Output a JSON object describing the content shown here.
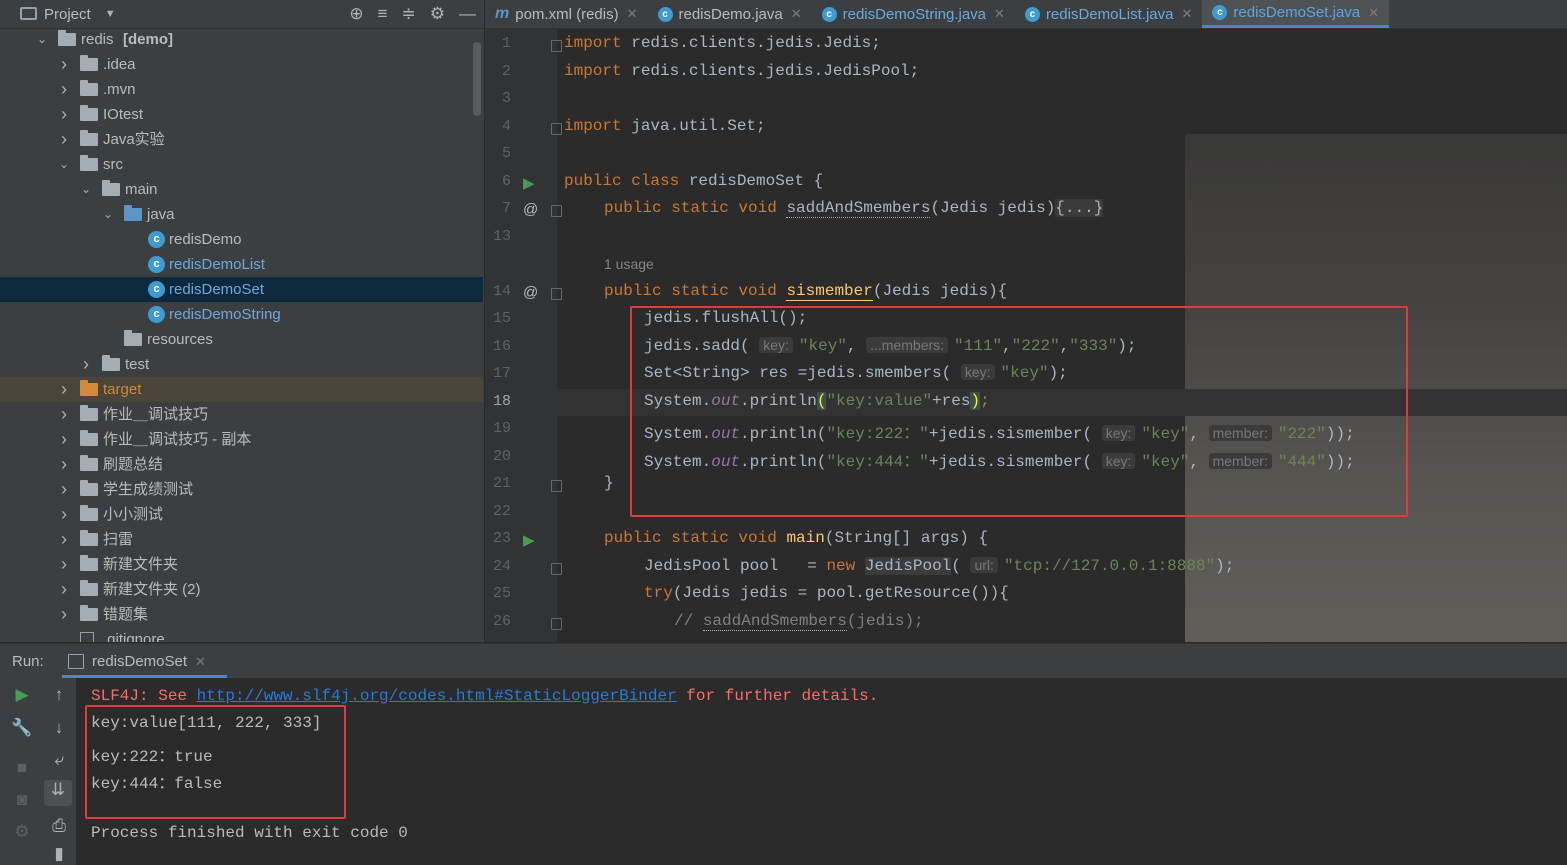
{
  "project_panel": {
    "title": "Project",
    "tree": [
      {
        "label": "redis",
        "suffix": "[demo]",
        "level": 0,
        "arrow": "down",
        "icon": "module-folder"
      },
      {
        "label": ".idea",
        "level": 1,
        "arrow": "right",
        "icon": "folder"
      },
      {
        "label": ".mvn",
        "level": 1,
        "arrow": "right",
        "icon": "folder"
      },
      {
        "label": "IOtest",
        "level": 1,
        "arrow": "right",
        "icon": "folder"
      },
      {
        "label": "Java实验",
        "level": 1,
        "arrow": "right",
        "icon": "folder"
      },
      {
        "label": "src",
        "level": 1,
        "arrow": "down",
        "icon": "folder"
      },
      {
        "label": "main",
        "level": 2,
        "arrow": "down",
        "icon": "folder"
      },
      {
        "label": "java",
        "level": 3,
        "arrow": "down",
        "icon": "blue-folder"
      },
      {
        "label": "redisDemo",
        "level": 4,
        "icon": "class"
      },
      {
        "label": "redisDemoList",
        "level": 4,
        "icon": "class",
        "color": "#6fa9dc"
      },
      {
        "label": "redisDemoSet",
        "level": 4,
        "icon": "class",
        "color": "#6fa9dc",
        "selected": true
      },
      {
        "label": "redisDemoString",
        "level": 4,
        "icon": "class",
        "color": "#6fa9dc"
      },
      {
        "label": "resources",
        "level": 3,
        "icon": "resources-folder"
      },
      {
        "label": "test",
        "level": 2,
        "arrow": "right",
        "icon": "folder"
      },
      {
        "label": "target",
        "level": 1,
        "arrow": "right",
        "icon": "orange-folder",
        "color": "#d08a3a",
        "target": true
      },
      {
        "label": "作业＿调试技巧",
        "level": 1,
        "arrow": "right",
        "icon": "folder"
      },
      {
        "label": "作业＿调试技巧 - 副本",
        "level": 1,
        "arrow": "right",
        "icon": "folder"
      },
      {
        "label": "刷题总结",
        "level": 1,
        "arrow": "right",
        "icon": "folder"
      },
      {
        "label": "学生成绩测试",
        "level": 1,
        "arrow": "right",
        "icon": "folder"
      },
      {
        "label": "小小测试",
        "level": 1,
        "arrow": "right",
        "icon": "folder"
      },
      {
        "label": "扫雷",
        "level": 1,
        "arrow": "right",
        "icon": "folder"
      },
      {
        "label": "新建文件夹",
        "level": 1,
        "arrow": "right",
        "icon": "folder"
      },
      {
        "label": "新建文件夹 (2)",
        "level": 1,
        "arrow": "right",
        "icon": "folder"
      },
      {
        "label": "错题集",
        "level": 1,
        "arrow": "right",
        "icon": "folder"
      },
      {
        "label": ".gitignore",
        "level": 1,
        "icon": "file"
      }
    ]
  },
  "tabs": [
    {
      "label": "pom.xml (redis)",
      "icon": "maven"
    },
    {
      "label": "redisDemo.java",
      "icon": "class"
    },
    {
      "label": "redisDemoString.java",
      "icon": "class",
      "blue": true
    },
    {
      "label": "redisDemoList.java",
      "icon": "class",
      "blue": true
    },
    {
      "label": "redisDemoSet.java",
      "icon": "class",
      "active": true
    }
  ],
  "editor": {
    "line_numbers": [
      "1",
      "2",
      "3",
      "4",
      "5",
      "6",
      "7",
      "13",
      "",
      "14",
      "15",
      "16",
      "17",
      "18",
      "19",
      "20",
      "21",
      "22",
      "23",
      "24",
      "25",
      "26"
    ],
    "usage_hint": "1 usage",
    "code": {
      "l1": [
        "import",
        " redis.clients.jedis.Jedis;"
      ],
      "l2": [
        "import",
        " redis.clients.jedis.JedisPool;"
      ],
      "l4": [
        "import",
        " java.util.Set;"
      ],
      "l6": [
        "public class",
        " redisDemoSet {"
      ],
      "l7": [
        "public static void",
        " ",
        "saddAndSmembers",
        "(Jedis jedis)",
        "{...}"
      ],
      "l14": [
        "public static void",
        " ",
        "sismember",
        "(Jedis jedis){"
      ],
      "l15": "jedis.flushAll();",
      "l16": [
        "jedis.sadd( ",
        "key:",
        "\"key\"",
        ", ",
        "...members:",
        "\"111\"",
        ",",
        "\"222\"",
        ",",
        "\"333\"",
        ");"
      ],
      "l17": [
        "Set<String> res =jedis.smembers( ",
        "key:",
        "\"key\"",
        ");"
      ],
      "l18": [
        "System.",
        "out",
        ".println",
        "(",
        "\"key:value\"",
        "+res",
        ")",
        ";"
      ],
      "l19": [
        "System.",
        "out",
        ".println(",
        "\"key:222：\"",
        "+jedis.sismember( ",
        "key:",
        "\"key\"",
        ", ",
        "member:",
        "\"222\"",
        "));"
      ],
      "l20": [
        "System.",
        "out",
        ".println(",
        "\"key:444：\"",
        "+jedis.sismember( ",
        "key:",
        "\"key\"",
        ", ",
        "member:",
        "\"444\"",
        "));"
      ],
      "l21": "}",
      "l23": [
        "public static void",
        " ",
        "main",
        "(String[] args) {"
      ],
      "l24": [
        "JedisPool pool   = ",
        "new",
        " ",
        "JedisPool",
        "( ",
        "url:",
        "\"tcp://127.0.0.1:8888\"",
        ");"
      ],
      "l25": [
        "try",
        "(Jedis jedis = pool.getResource()){"
      ],
      "l26": [
        "// ",
        "saddAndSmembers",
        "(jedis);"
      ]
    }
  },
  "run_panel": {
    "label": "Run:",
    "tab": "redisDemoSet",
    "console": {
      "slf4j_prefix": "SLF4J: See ",
      "slf4j_link": "http://www.slf4j.org/codes.html#StaticLoggerBinder",
      "slf4j_suffix": " for further details.",
      "output": [
        "key:value[111, 222, 333]",
        "key:222：true",
        "key:444：false"
      ],
      "finish": "Process finished with exit code 0"
    }
  },
  "colors": {
    "keyword": "#cc7832",
    "string": "#6a8759",
    "method": "#ffc66d",
    "field": "#9876aa",
    "highlight_box": "#e0393e",
    "accent": "#4a88c7"
  }
}
